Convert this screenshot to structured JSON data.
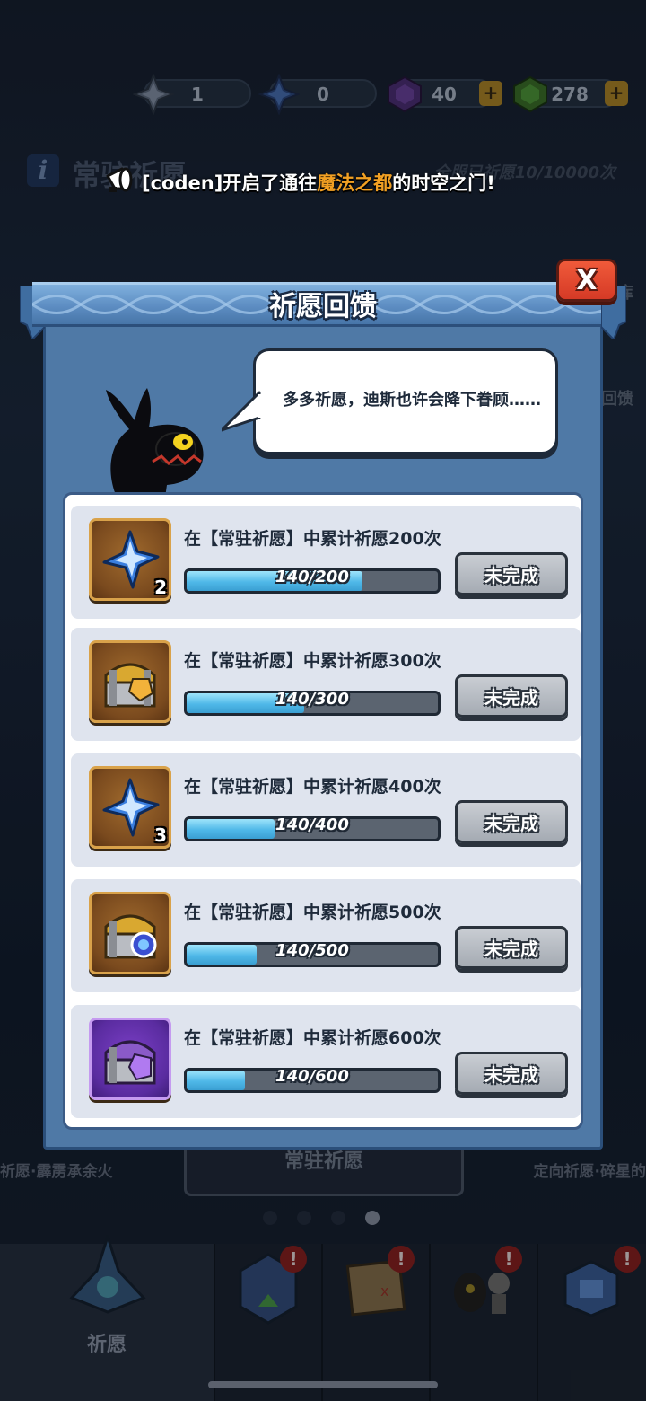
{
  "resources": [
    {
      "icon": "silver-star-crystal-icon",
      "value": "1"
    },
    {
      "icon": "blue-star-crystal-icon",
      "value": "0"
    },
    {
      "icon": "purple-gem-icon",
      "value": "40",
      "plus": "+"
    },
    {
      "icon": "green-gem-icon",
      "value": "278",
      "plus": "+"
    }
  ],
  "background": {
    "info_badge": "i",
    "page_title": "常驻祈愿",
    "count_text": "全服已祈愿10/10000次",
    "side_label_1": "库",
    "side_label_2": "回馈"
  },
  "broadcast": {
    "prefix": "[coden]开启了通往",
    "highlight": "魔法之都",
    "suffix": "的时空之门!"
  },
  "modal": {
    "title": "祈愿回馈",
    "close_label": "X",
    "speech": "多多祈愿，迪斯也许会降下眷顾……",
    "accent_color": "#f2a023"
  },
  "tasks": [
    {
      "desc": "在【常驻祈愿】中累计祈愿200次",
      "progress": "140/200",
      "current": 140,
      "target": 200,
      "reward_icon": "blue-star-crystal-icon",
      "qty": "2",
      "status": "未完成"
    },
    {
      "desc": "在【常驻祈愿】中累计祈愿300次",
      "progress": "140/300",
      "current": 140,
      "target": 300,
      "reward_icon": "gold-treasure-chest-icon",
      "qty": "",
      "status": "未完成"
    },
    {
      "desc": "在【常驻祈愿】中累计祈愿400次",
      "progress": "140/400",
      "current": 140,
      "target": 400,
      "reward_icon": "blue-star-crystal-icon",
      "qty": "3",
      "status": "未完成"
    },
    {
      "desc": "在【常驻祈愿】中累计祈愿500次",
      "progress": "140/500",
      "current": 140,
      "target": 500,
      "reward_icon": "gold-orb-chest-icon",
      "qty": "",
      "status": "未完成"
    },
    {
      "desc": "在【常驻祈愿】中累计祈愿600次",
      "progress": "140/600",
      "current": 140,
      "target": 600,
      "reward_icon": "purple-treasure-chest-icon",
      "qty": "",
      "status": "未完成"
    }
  ],
  "carousel": {
    "left_label": "祈愿·霹雳承余火",
    "center_label": "常驻祈愿",
    "right_label": "定向祈愿·碎星的"
  },
  "bottom_nav": [
    {
      "label": "祈愿",
      "icon": "crystal-spire-icon",
      "badge": ""
    },
    {
      "label": "",
      "icon": "hexagon-upgrade-icon",
      "badge": "!"
    },
    {
      "label": "",
      "icon": "treasure-map-icon",
      "badge": "!"
    },
    {
      "label": "",
      "icon": "heroes-icon",
      "badge": "!"
    },
    {
      "label": "",
      "icon": "gift-box-icon",
      "badge": "!"
    }
  ]
}
